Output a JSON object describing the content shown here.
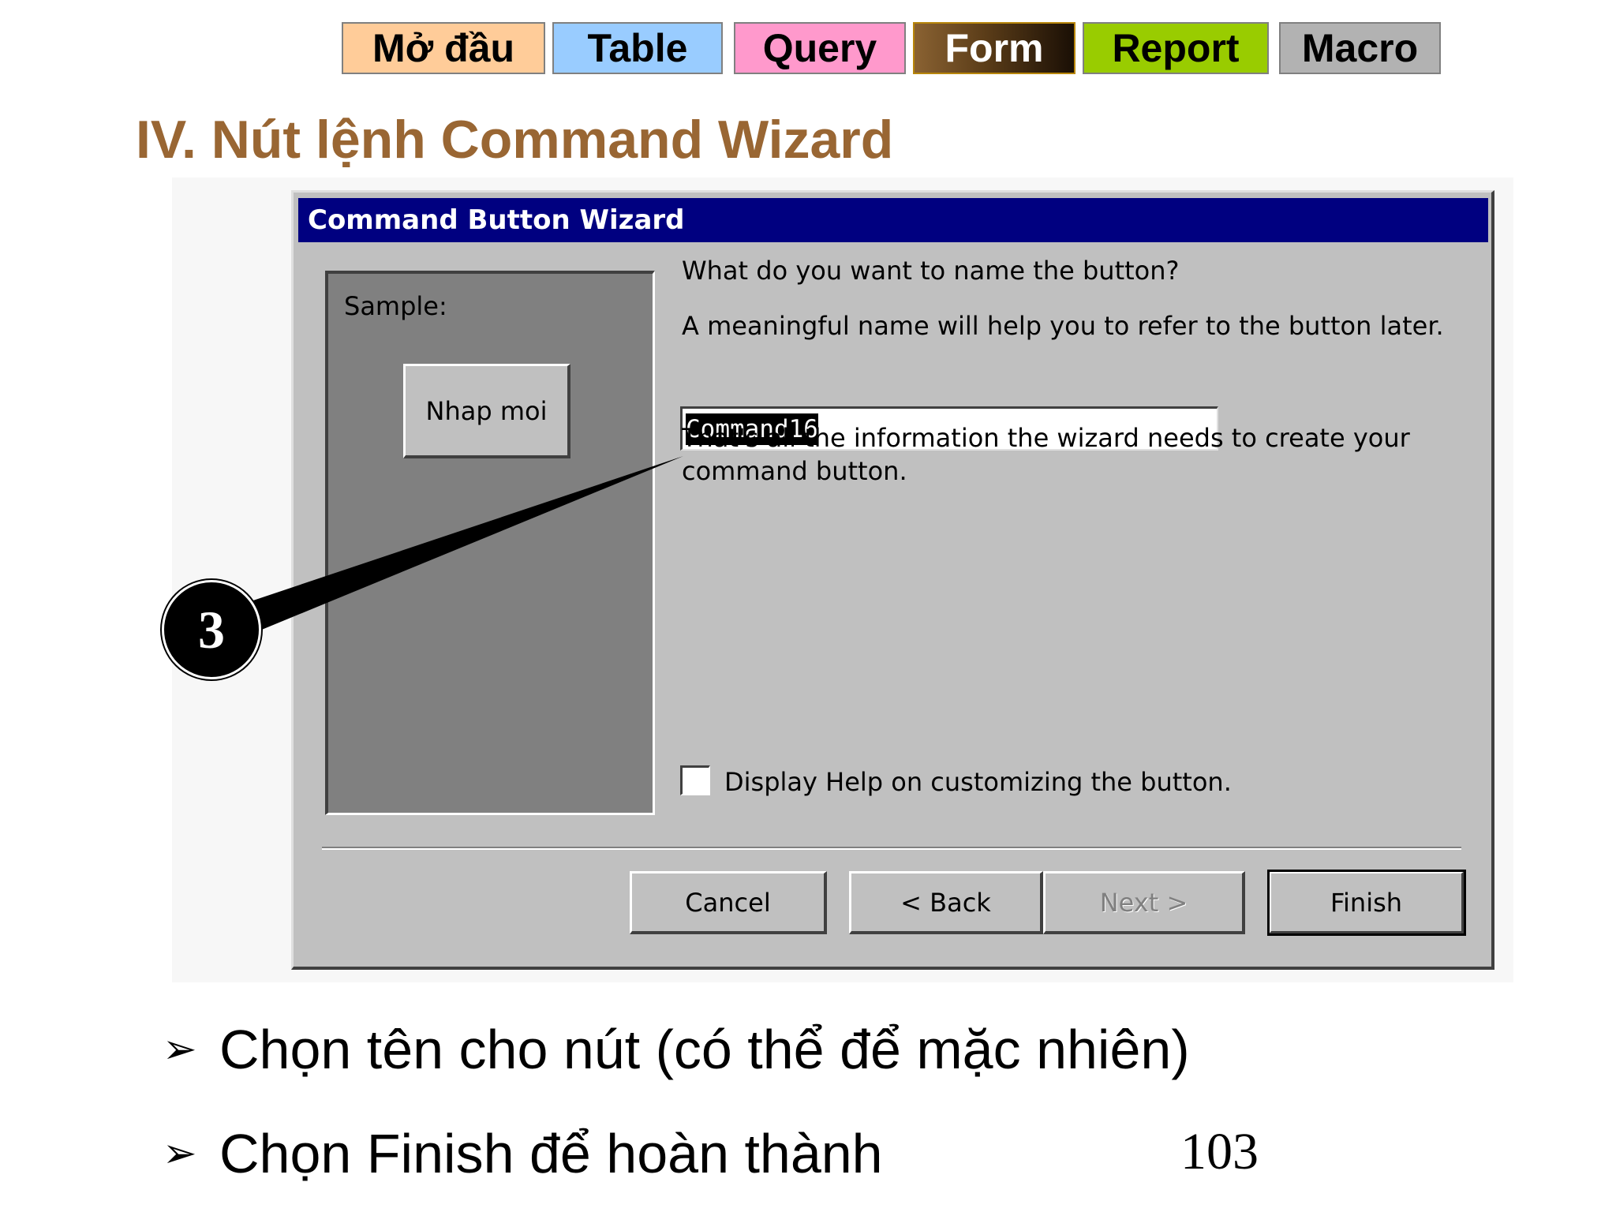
{
  "nav": {
    "tabs": [
      {
        "label": "Mở đầu"
      },
      {
        "label": "Table"
      },
      {
        "label": "Query"
      },
      {
        "label": "Form"
      },
      {
        "label": "Report"
      },
      {
        "label": "Macro"
      }
    ]
  },
  "slide": {
    "title": "IV. Nút lệnh Command Wizard",
    "callout_number": "3",
    "page_number": "103",
    "bullets": [
      {
        "marker": "➢",
        "text": "Chọn tên cho nút (có thể để mặc nhiên)"
      },
      {
        "marker": "➢",
        "text": "Chọn Finish để hoàn thành"
      }
    ]
  },
  "dialog": {
    "title": "Command Button Wizard",
    "sample_label": "Sample:",
    "sample_button_label": "Nhap moi",
    "question": "What do you want to name the button?",
    "hint": "A meaningful name will help you to refer to the button later.",
    "name_value": "Command16",
    "info_line1": "That's all the information the wizard needs to create your",
    "info_line2": "command button.",
    "checkbox_label": "Display Help on customizing the button.",
    "checkbox_checked": false,
    "buttons": {
      "cancel": "Cancel",
      "back": "< Back",
      "next": "Next >",
      "finish": "Finish"
    }
  },
  "colors": {
    "title_bar": "#000080",
    "dialog_face": "#c0c0c0",
    "slide_title": "#996633",
    "tab_mo_dau": "#ffcc99",
    "tab_table": "#99ccff",
    "tab_query": "#ff99cc",
    "tab_form": "#5a3c18",
    "tab_report": "#99cc00",
    "tab_macro": "#b2b2b2"
  }
}
